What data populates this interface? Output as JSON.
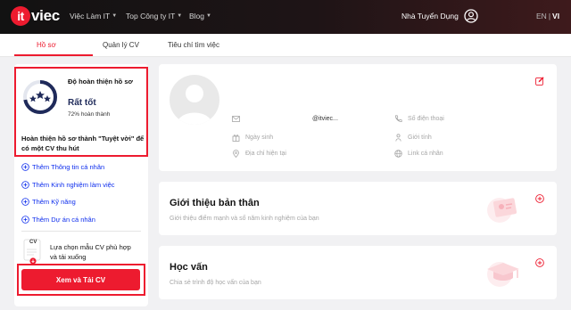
{
  "header": {
    "logo_it": "it",
    "logo_rest": "viec",
    "nav": [
      {
        "label": "Việc Làm IT"
      },
      {
        "label": "Top Công ty IT"
      },
      {
        "label": "Blog"
      }
    ],
    "employer": "Nhà Tuyển Dụng",
    "lang_en": "EN",
    "lang_sep": "|",
    "lang_vi": "VI"
  },
  "tabs": [
    {
      "label": "Hồ sơ",
      "active": true
    },
    {
      "label": "Quản lý CV",
      "active": false
    },
    {
      "label": "Tiêu chí tìm việc",
      "active": false
    }
  ],
  "sidebar": {
    "completion_title": "Độ hoàn thiện hồ sơ",
    "completion_level": "Rất tốt",
    "completion_percent_text": "72% hoàn thành",
    "completion_value": 0.72,
    "completion_message": "Hoàn thiện hồ sơ thành \"Tuyệt vời\" để có một CV thu hút",
    "add_items": [
      {
        "label": "Thêm Thông tin cá nhân"
      },
      {
        "label": "Thêm Kinh nghiệm làm việc"
      },
      {
        "label": "Thêm Kỹ năng"
      },
      {
        "label": "Thêm Dự án cá nhân"
      }
    ],
    "cv_badge": "CV",
    "cv_prompt": "Lựa chọn mẫu CV phù hợp và tải xuống",
    "cta_label": "Xem và Tải CV"
  },
  "profile": {
    "email": "@itviec...",
    "phone_placeholder": "Số điện thoại",
    "birthday_placeholder": "Ngày sinh",
    "gender_placeholder": "Giới tính",
    "address_placeholder": "Địa chỉ hiện tại",
    "link_placeholder": "Link cá nhân"
  },
  "sections": [
    {
      "title": "Giới thiệu bản thân",
      "description": "Giới thiệu điểm mạnh và số năm kinh nghiệm của bạn"
    },
    {
      "title": "Học vấn",
      "description": "Chia sẻ trình độ học vấn của bạn"
    }
  ],
  "colors": {
    "accent": "#ed1b2f",
    "link": "#0e2eed",
    "level": "#1f2a5a"
  }
}
